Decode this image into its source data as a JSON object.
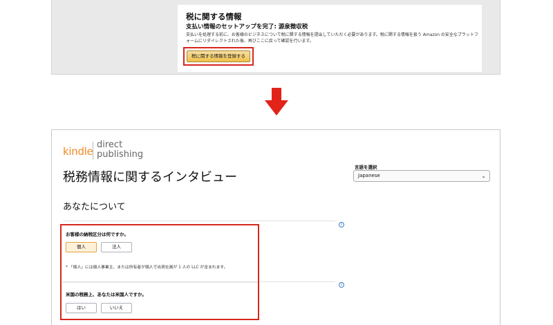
{
  "top_card": {
    "heading": "税に関する情報",
    "subheading": "支払い情報のセットアップを完了: 源泉徴収税",
    "description": "支払いを処理する前に、お客様のビジネスについて税に関する情報を提出していただく必要があります。税に関する情報を扱う Amazon の安全なプラットフォームにリダイレクトされた後、再びここに戻って確認を行います。",
    "register_button": "税に関する情報を登録する"
  },
  "bottom_panel": {
    "logo": {
      "kindle": "kindle",
      "direct": "direct",
      "publishing": "publishing"
    },
    "page_title": "税務情報に関するインタビュー",
    "language": {
      "label": "言語を選択",
      "selected": "Japanese"
    },
    "section_title": "あなたについて",
    "info_icon": "i",
    "question1": {
      "label": "お客様の納税区分は何ですか。",
      "options": [
        "個人",
        "法人"
      ],
      "selected": "個人",
      "note": "* 「個人」には個人事業主、または所有者が個人で出資社員が 1 人の LLC が含まれます。"
    },
    "question2": {
      "label": "米国の税務上、あなたは米国人ですか。",
      "options": [
        "はい",
        "いいえ"
      ]
    }
  },
  "colors": {
    "highlight": "#d6261c",
    "kindle_orange": "#f08a24",
    "button_gold": "#f0c14b",
    "arrow_red": "#e2231a"
  },
  "icons": {
    "arrow": "arrow-down-icon",
    "info": "info-icon",
    "dropdown": "chevron-down-icon"
  }
}
